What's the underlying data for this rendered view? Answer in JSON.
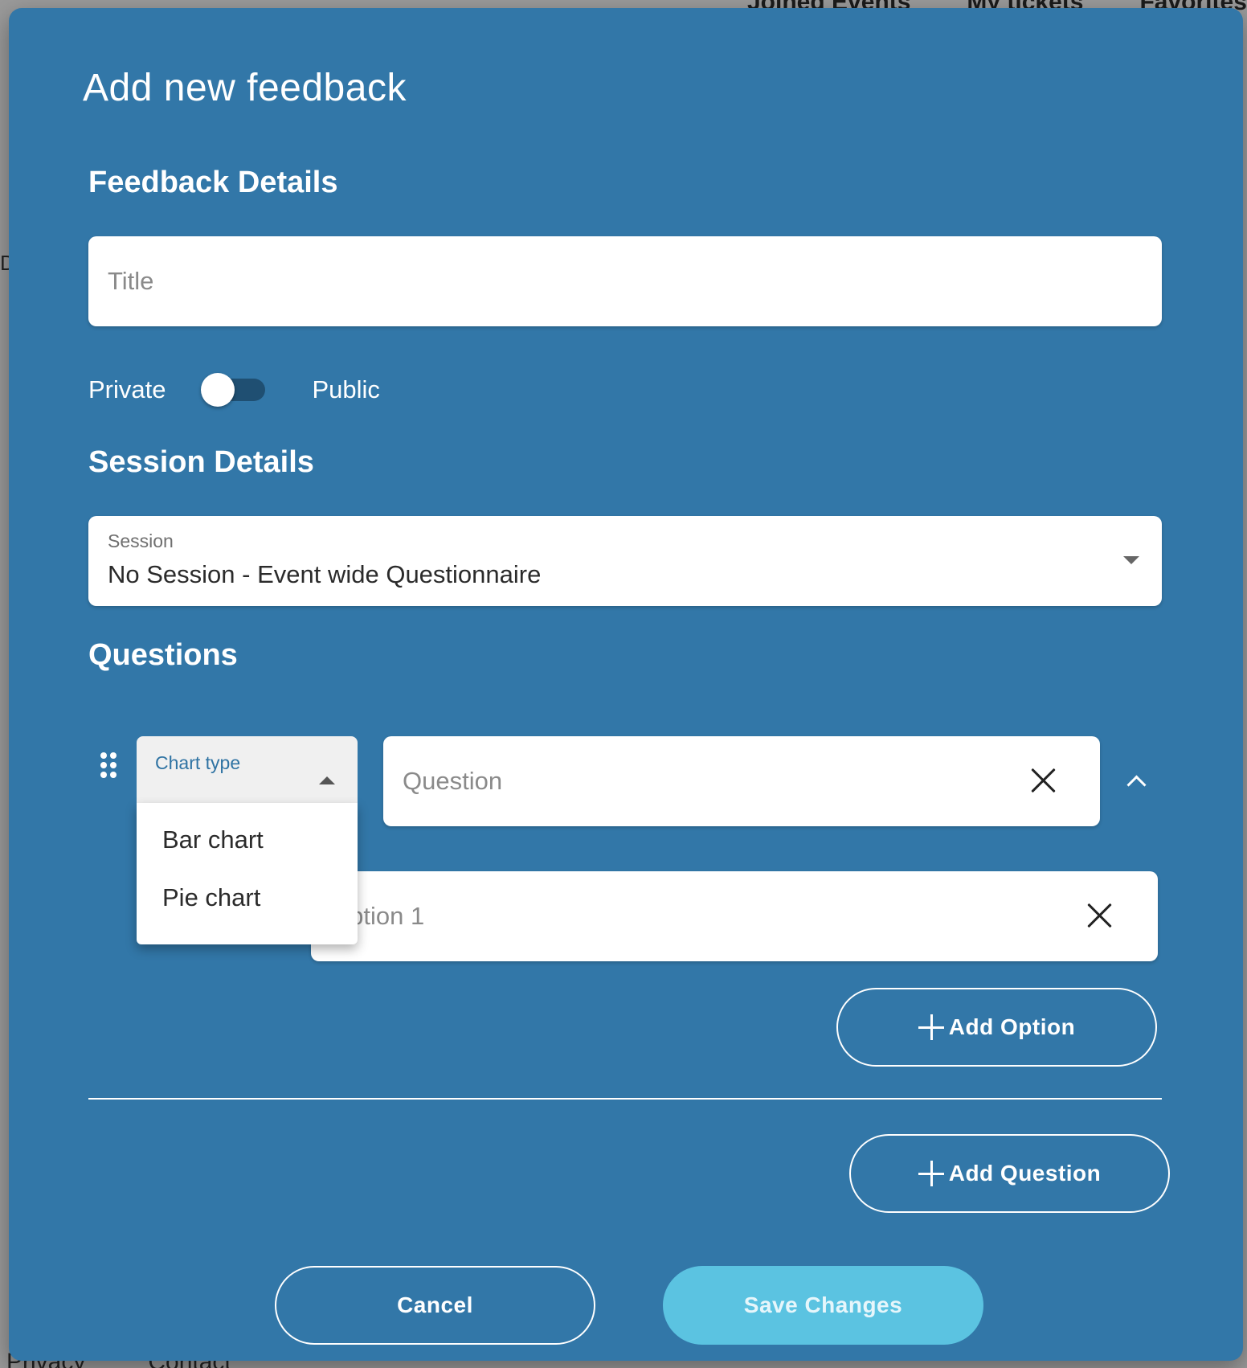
{
  "backdrop": {
    "nav": [
      "Joined Events",
      "My tickets",
      "Favorites"
    ],
    "footer": [
      "Privacy",
      "Contact"
    ],
    "side_letter": "D"
  },
  "modal": {
    "title": "Add new feedback"
  },
  "feedback_details": {
    "heading": "Feedback Details",
    "title_placeholder": "Title",
    "toggle_left_label": "Private",
    "toggle_right_label": "Public"
  },
  "session_details": {
    "heading": "Session Details",
    "label": "Session",
    "value": "No Session - Event wide Questionnaire"
  },
  "questions": {
    "heading": "Questions",
    "chart_type_label": "Chart type",
    "chart_type_options": [
      "Bar chart",
      "Pie chart"
    ],
    "question_placeholder": "Question",
    "option_placeholder": "Option 1",
    "add_option_label": "Add Option",
    "add_question_label": "Add Question"
  },
  "actions": {
    "cancel_label": "Cancel",
    "save_label": "Save Changes"
  }
}
